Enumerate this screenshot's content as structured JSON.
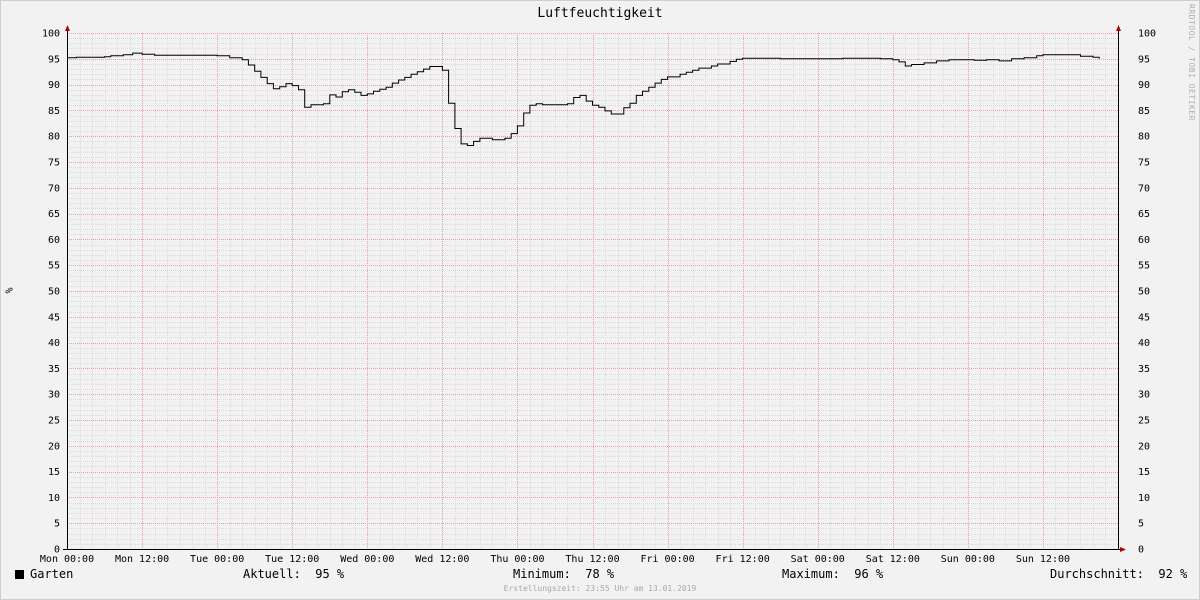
{
  "chart_data": {
    "type": "line",
    "title": "Luftfeuchtigkeit",
    "ylabel": "%",
    "ylim": [
      0,
      100
    ],
    "y_ticks": [
      0,
      5,
      10,
      15,
      20,
      25,
      30,
      35,
      40,
      45,
      50,
      55,
      60,
      65,
      70,
      75,
      80,
      85,
      90,
      95,
      100
    ],
    "x_tick_labels": [
      "Mon 00:00",
      "Mon 12:00",
      "Tue 00:00",
      "Tue 12:00",
      "Wed 00:00",
      "Wed 12:00",
      "Thu 00:00",
      "Thu 12:00",
      "Fri 00:00",
      "Fri 12:00",
      "Sat 00:00",
      "Sat 12:00",
      "Sun 00:00",
      "Sun 12:00"
    ],
    "x_unit": "hours since Mon 00:00",
    "xlim": [
      0,
      168
    ],
    "grid": true,
    "series": [
      {
        "name": "Garten",
        "color": "#000000",
        "points": [
          [
            0,
            95.2
          ],
          [
            1.5,
            95.3
          ],
          [
            6,
            95.4
          ],
          [
            7,
            95.6
          ],
          [
            9,
            95.8
          ],
          [
            10.5,
            96.1
          ],
          [
            12,
            95.9
          ],
          [
            14,
            95.7
          ],
          [
            24,
            95.6
          ],
          [
            26,
            95.2
          ],
          [
            28,
            94.8
          ],
          [
            29,
            93.8
          ],
          [
            30,
            92.6
          ],
          [
            31,
            91.4
          ],
          [
            32,
            90.2
          ],
          [
            33,
            89.2
          ],
          [
            34,
            89.6
          ],
          [
            35,
            90.2
          ],
          [
            36,
            89.8
          ],
          [
            37,
            89.0
          ],
          [
            38,
            85.6
          ],
          [
            39,
            86.1
          ],
          [
            41,
            86.3
          ],
          [
            42,
            88.0
          ],
          [
            43,
            87.6
          ],
          [
            44,
            88.6
          ],
          [
            45,
            89.0
          ],
          [
            46,
            88.5
          ],
          [
            47,
            87.9
          ],
          [
            48,
            88.2
          ],
          [
            49,
            88.7
          ],
          [
            50,
            89.1
          ],
          [
            51,
            89.5
          ],
          [
            52,
            90.3
          ],
          [
            53,
            90.9
          ],
          [
            54,
            91.4
          ],
          [
            55,
            92.0
          ],
          [
            56,
            92.5
          ],
          [
            57,
            93.0
          ],
          [
            58,
            93.5
          ],
          [
            60,
            92.8
          ],
          [
            61,
            86.4
          ],
          [
            62,
            81.5
          ],
          [
            63,
            78.5
          ],
          [
            64,
            78.2
          ],
          [
            65,
            79.0
          ],
          [
            66,
            79.6
          ],
          [
            68,
            79.3
          ],
          [
            70,
            79.6
          ],
          [
            71,
            80.5
          ],
          [
            72,
            82.0
          ],
          [
            73,
            84.5
          ],
          [
            74,
            86.0
          ],
          [
            75,
            86.3
          ],
          [
            76,
            86.1
          ],
          [
            80,
            86.3
          ],
          [
            81,
            87.5
          ],
          [
            82,
            87.9
          ],
          [
            83,
            86.8
          ],
          [
            84,
            86.0
          ],
          [
            85,
            85.6
          ],
          [
            86,
            84.9
          ],
          [
            87,
            84.3
          ],
          [
            89,
            85.5
          ],
          [
            90,
            86.4
          ],
          [
            91,
            87.9
          ],
          [
            92,
            88.7
          ],
          [
            93,
            89.5
          ],
          [
            94,
            90.3
          ],
          [
            95,
            91.0
          ],
          [
            96,
            91.5
          ],
          [
            98,
            92.0
          ],
          [
            99,
            92.4
          ],
          [
            100,
            92.8
          ],
          [
            101,
            93.2
          ],
          [
            103,
            93.6
          ],
          [
            104,
            94.0
          ],
          [
            106,
            94.5
          ],
          [
            107,
            94.9
          ],
          [
            108,
            95.1
          ],
          [
            114,
            95.0
          ],
          [
            124,
            95.1
          ],
          [
            130,
            95.0
          ],
          [
            132,
            94.8
          ],
          [
            133,
            94.4
          ],
          [
            134,
            93.6
          ],
          [
            135,
            93.9
          ],
          [
            137,
            94.2
          ],
          [
            139,
            94.6
          ],
          [
            141,
            94.8
          ],
          [
            145,
            94.7
          ],
          [
            147,
            94.8
          ],
          [
            149,
            94.6
          ],
          [
            151,
            95.0
          ],
          [
            153,
            95.2
          ],
          [
            155,
            95.6
          ],
          [
            156,
            95.8
          ],
          [
            162,
            95.5
          ],
          [
            163,
            95.5
          ],
          [
            164,
            95.3
          ],
          [
            165,
            95.0
          ]
        ]
      }
    ],
    "legend_name": "Garten",
    "stats": {
      "current_label": "Aktuell:",
      "current_value": "95 %",
      "min_label": "Minimum:",
      "min_value": "78 %",
      "max_label": "Maximum:",
      "max_value": "96 %",
      "avg_label": "Durchschnitt:",
      "avg_value": "92 %"
    }
  },
  "watermark": "RRDTOOL / TOBI OETIKER",
  "footer": "Erstellungszeit: 23:55 Uhr am 13.01.2019",
  "colors": {
    "major_grid": "#e8a0a0",
    "minor_grid": "#dcdcdc",
    "axis": "#000000",
    "arrow": "#b00000"
  }
}
